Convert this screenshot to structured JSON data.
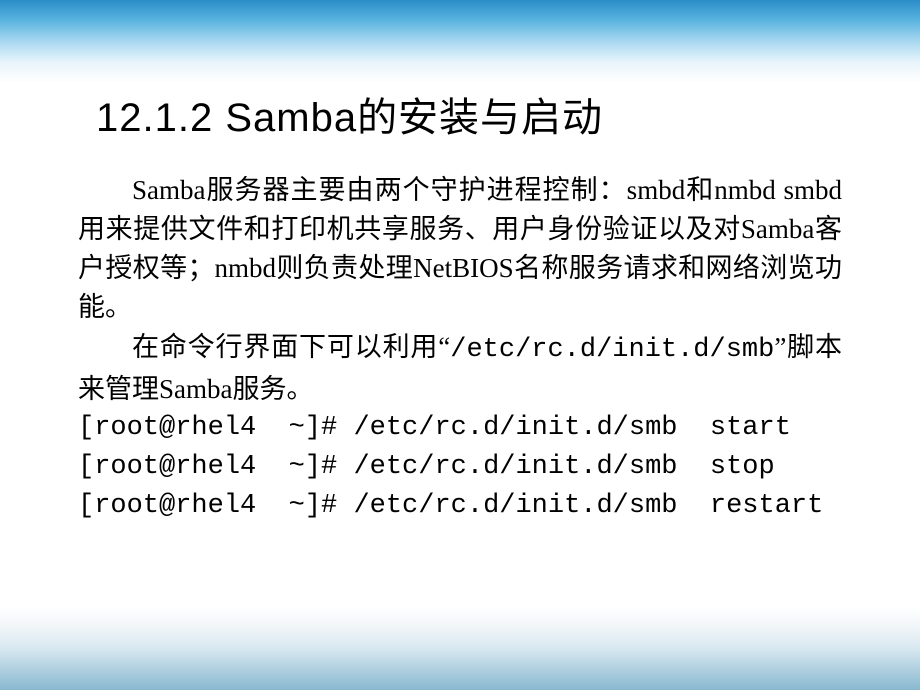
{
  "title": "12.1.2  Samba的安装与启动",
  "para1": "Samba服务器主要由两个守护进程控制：smbd和nmbd smbd用来提供文件和打印机共享服务、用户身份验证以及对Samba客户授权等；nmbd则负责处理NetBIOS名称服务请求和网络浏览功能。",
  "para2_prefix": "在命令行界面下可以利用“",
  "para2_path": "/etc/rc.d/init.d/smb",
  "para2_suffix": "”脚本来管理Samba服务。",
  "cmd1": "[root@rhel4  ~]# /etc/rc.d/init.d/smb  start",
  "cmd2": "[root@rhel4  ~]# /etc/rc.d/init.d/smb  stop",
  "cmd3": "[root@rhel4  ~]# /etc/rc.d/init.d/smb  restart"
}
